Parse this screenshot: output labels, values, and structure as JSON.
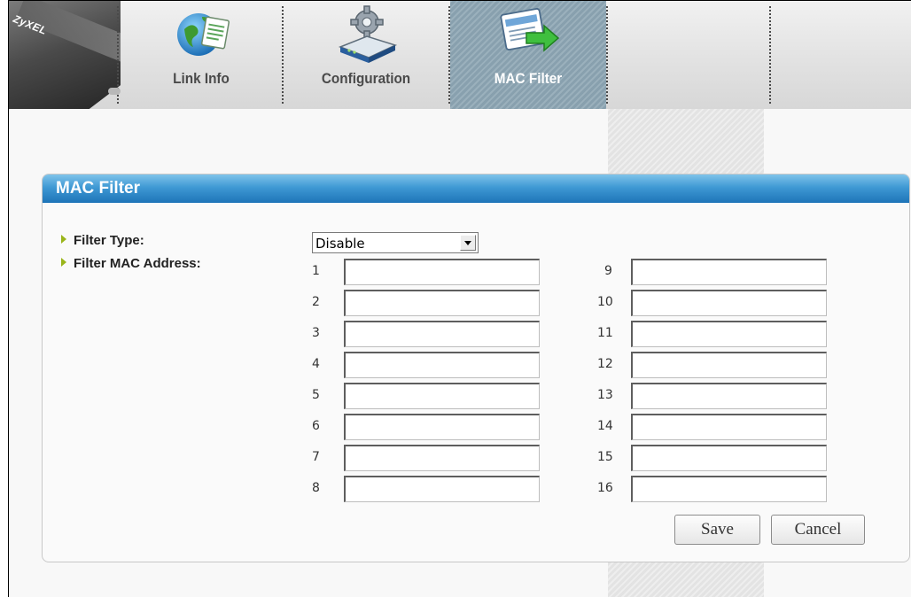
{
  "brand": "ZyXEL",
  "nav": {
    "tabs": [
      {
        "label": "Link Info",
        "icon": "globe-document-icon",
        "active": false
      },
      {
        "label": "Configuration",
        "icon": "router-gear-icon",
        "active": false
      },
      {
        "label": "MAC Filter",
        "icon": "mac-filter-icon",
        "active": true
      }
    ]
  },
  "panel": {
    "title": "MAC Filter",
    "filter_type_label": "Filter Type:",
    "filter_type_value": "Disable",
    "filter_mac_label": "Filter MAC Address:",
    "mac_left": [
      {
        "num": "1",
        "value": ""
      },
      {
        "num": "2",
        "value": ""
      },
      {
        "num": "3",
        "value": ""
      },
      {
        "num": "4",
        "value": ""
      },
      {
        "num": "5",
        "value": ""
      },
      {
        "num": "6",
        "value": ""
      },
      {
        "num": "7",
        "value": ""
      },
      {
        "num": "8",
        "value": ""
      }
    ],
    "mac_right": [
      {
        "num": "9",
        "value": ""
      },
      {
        "num": "10",
        "value": ""
      },
      {
        "num": "11",
        "value": ""
      },
      {
        "num": "12",
        "value": ""
      },
      {
        "num": "13",
        "value": ""
      },
      {
        "num": "14",
        "value": ""
      },
      {
        "num": "15",
        "value": ""
      },
      {
        "num": "16",
        "value": ""
      }
    ]
  },
  "buttons": {
    "save": "Save",
    "cancel": "Cancel"
  },
  "colors": {
    "header_blue": "#2e86c8",
    "active_tab": "#8fa8b6",
    "bullet_green": "#9ab51a"
  }
}
